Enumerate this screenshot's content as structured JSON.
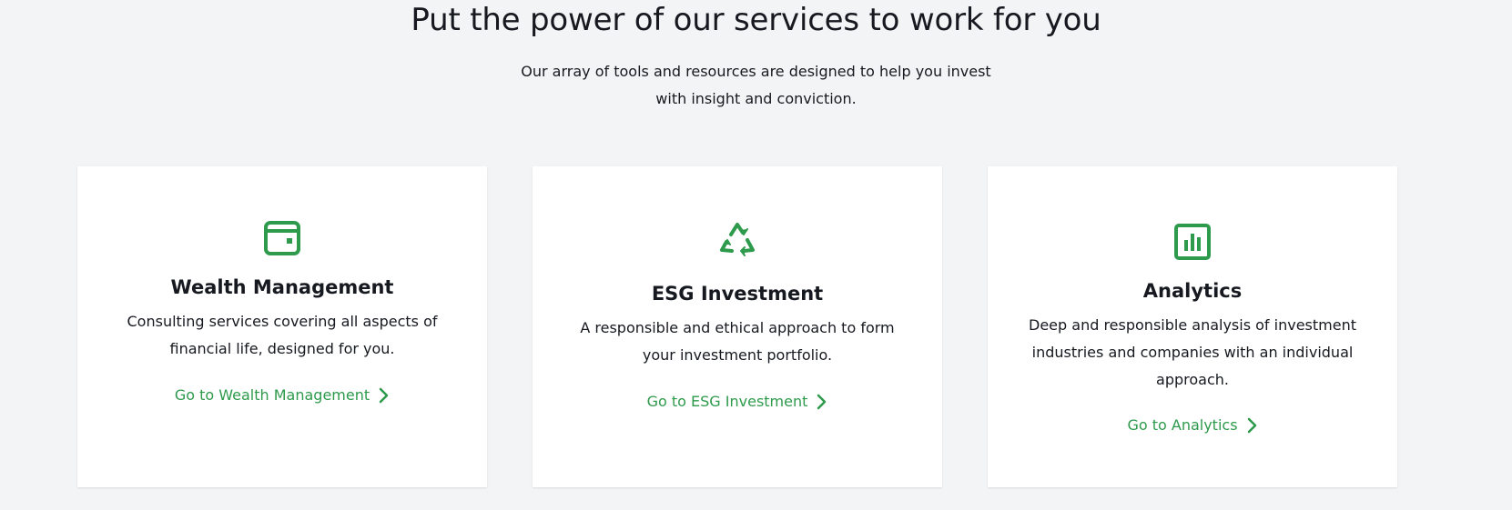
{
  "section": {
    "heading": "Put the power of our services to work for you",
    "subheading": "Our array of tools and resources are designed to help you invest with insight and conviction."
  },
  "colors": {
    "accent": "#2e9a4c",
    "background": "#f3f4f6",
    "card": "#ffffff",
    "text": "#16191f"
  },
  "cards": [
    {
      "icon": "wallet-icon",
      "title": "Wealth Management",
      "description": "Consulting services covering all aspects of financial life, designed for you.",
      "link_label": "Go to Wealth Management"
    },
    {
      "icon": "recycle-icon",
      "title": "ESG Investment",
      "description": "A responsible and ethical approach to form your investment portfolio.",
      "link_label": "Go to ESG Investment"
    },
    {
      "icon": "bar-chart-icon",
      "title": "Analytics",
      "description": "Deep and responsible analysis of investment industries and companies with an individual approach.",
      "link_label": "Go to Analytics"
    }
  ]
}
